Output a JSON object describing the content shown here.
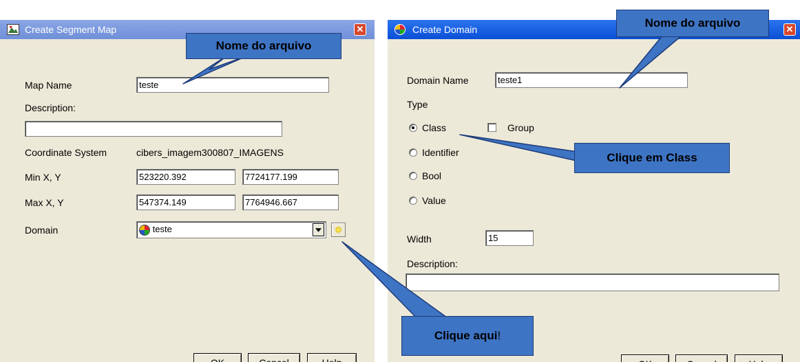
{
  "colors": {
    "titlebar_active": "#0a5ce5",
    "titlebar_inactive": "#7a96df",
    "close_button": "#d8472b",
    "callout_fill": "#3e74c4",
    "dialog_bg": "#ece9d8"
  },
  "left_dialog": {
    "title": "Create Segment Map",
    "title_icon": "segment-map-icon",
    "map_name_label": "Map Name",
    "map_name_value": "teste",
    "description_label": "Description:",
    "description_value": "",
    "coord_system_label": "Coordinate System",
    "coord_system_value": "cibers_imagem300807_IMAGENS",
    "min_label": "Min X, Y",
    "min_x": "523220.392",
    "min_y": "7724177.199",
    "max_label": "Max X, Y",
    "max_x": "547374.149",
    "max_y": "7764946.667",
    "domain_label": "Domain",
    "domain_value": "teste",
    "domain_icon": "domain-globe-icon",
    "buttons": {
      "ok": "OK",
      "cancel": "Cancel",
      "help": "Help"
    }
  },
  "right_dialog": {
    "title": "Create Domain",
    "title_icon": "domain-globe-icon",
    "domain_name_label": "Domain Name",
    "domain_name_value": "teste1",
    "type_label": "Type",
    "type_options": [
      "Class",
      "Identifier",
      "Bool",
      "Value"
    ],
    "selected_type": "Class",
    "group_label": "Group",
    "group_checked": false,
    "width_label": "Width",
    "width_value": "15",
    "description_label": "Description:",
    "description_value": "",
    "buttons": {
      "ok": "OK",
      "cancel": "Cancel",
      "help": "Help"
    }
  },
  "callouts": {
    "left_title": "Nome do arquivo",
    "right_title": "Nome do arquivo",
    "class_hint": "Clique em Class",
    "click_here_prefix": "Clique ",
    "click_here_bold": "aqui",
    "click_here_suffix": "!"
  }
}
